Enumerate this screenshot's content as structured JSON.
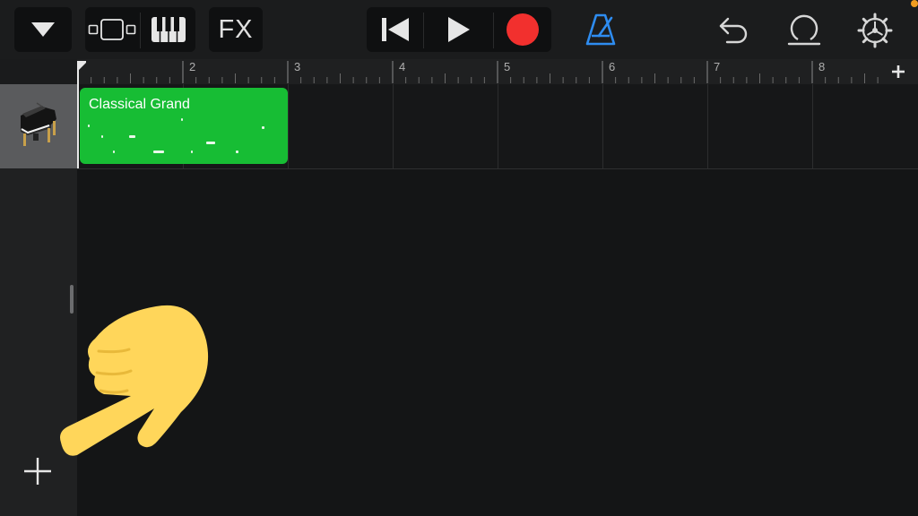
{
  "toolbar": {
    "menu_icon": "triangle-down-icon",
    "view_tracks_icon": "tracks-view-icon",
    "view_keyboard_icon": "piano-keys-icon",
    "fx_label": "FX",
    "rewind_icon": "skip-back-icon",
    "play_icon": "play-icon",
    "record_icon": "record-icon",
    "metronome_icon": "metronome-icon",
    "undo_icon": "undo-icon",
    "loop_icon": "loop-icon",
    "settings_icon": "gear-icon",
    "colors": {
      "record": "#f2302e",
      "metronome": "#2e8cf0",
      "status_dot": "#f29c1f"
    }
  },
  "ruler": {
    "bars": [
      "2",
      "3",
      "4",
      "5",
      "6",
      "7",
      "8"
    ],
    "add_section_icon": "plus-icon"
  },
  "tracks": [
    {
      "instrument_icon": "grand-piano-icon",
      "region": {
        "title": "Classical Grand",
        "color": "#17bd34"
      }
    }
  ],
  "sidebar": {
    "add_track_icon": "plus-icon"
  },
  "overlay": {
    "emoji": "backhand-index-pointing-down-left",
    "color": "#ffd65a"
  }
}
